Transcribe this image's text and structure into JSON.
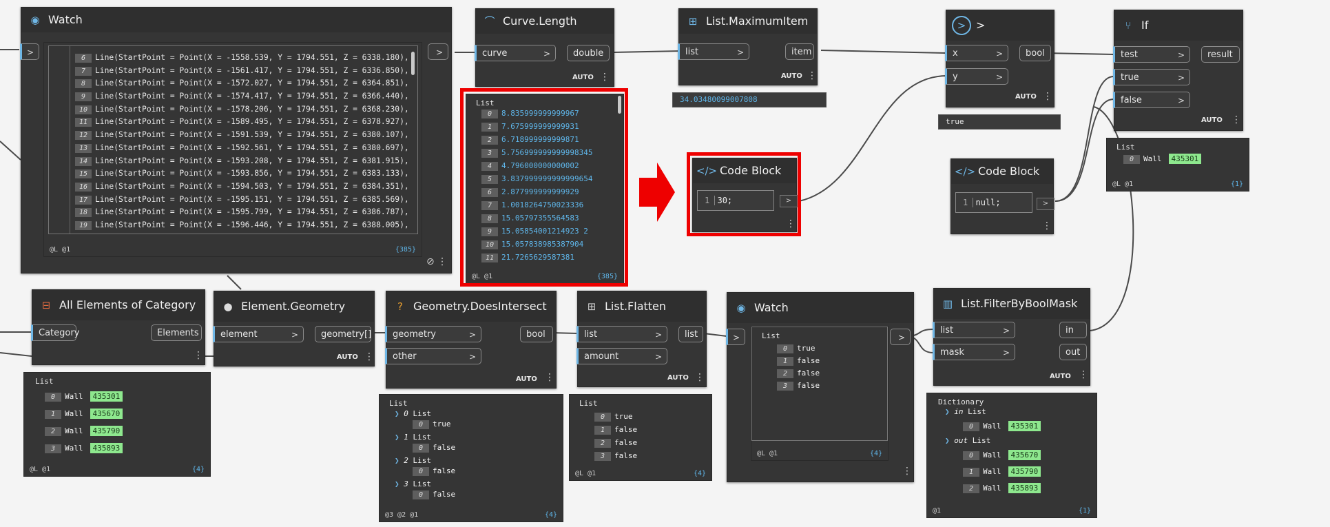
{
  "nodes": {
    "watch_top": {
      "title": "Watch",
      "lines": [
        {
          "i": "6",
          "t": "Line(StartPoint = Point(X = -1558.539, Y = 1794.551, Z = 6338.180),"
        },
        {
          "i": "7",
          "t": "Line(StartPoint = Point(X = -1561.417, Y = 1794.551, Z = 6336.850),"
        },
        {
          "i": "8",
          "t": "Line(StartPoint = Point(X = -1572.027, Y = 1794.551, Z = 6364.851),"
        },
        {
          "i": "9",
          "t": "Line(StartPoint = Point(X = -1574.417, Y = 1794.551, Z = 6366.440),"
        },
        {
          "i": "10",
          "t": "Line(StartPoint = Point(X = -1578.206, Y = 1794.551, Z = 6368.230),"
        },
        {
          "i": "11",
          "t": "Line(StartPoint = Point(X = -1589.495, Y = 1794.551, Z = 6378.927),"
        },
        {
          "i": "12",
          "t": "Line(StartPoint = Point(X = -1591.539, Y = 1794.551, Z = 6380.107),"
        },
        {
          "i": "13",
          "t": "Line(StartPoint = Point(X = -1592.561, Y = 1794.551, Z = 6380.697),"
        },
        {
          "i": "14",
          "t": "Line(StartPoint = Point(X = -1593.208, Y = 1794.551, Z = 6381.915),"
        },
        {
          "i": "15",
          "t": "Line(StartPoint = Point(X = -1593.856, Y = 1794.551, Z = 6383.133),"
        },
        {
          "i": "16",
          "t": "Line(StartPoint = Point(X = -1594.503, Y = 1794.551, Z = 6384.351),"
        },
        {
          "i": "17",
          "t": "Line(StartPoint = Point(X = -1595.151, Y = 1794.551, Z = 6385.569),"
        },
        {
          "i": "18",
          "t": "Line(StartPoint = Point(X = -1595.799, Y = 1794.551, Z = 6386.787),"
        },
        {
          "i": "19",
          "t": "Line(StartPoint = Point(X = -1596.446, Y = 1794.551, Z = 6388.005),"
        }
      ],
      "footer_left": "@L @1",
      "count": "{385}"
    },
    "curve_length": {
      "title": "Curve.Length",
      "in": "curve",
      "out": "double",
      "auto": "AUTO",
      "preview_title": "List",
      "values": [
        {
          "i": "0",
          "v": "8.835999999999967"
        },
        {
          "i": "1",
          "v": "7.675999999999931"
        },
        {
          "i": "2",
          "v": "6.718999999999871"
        },
        {
          "i": "3",
          "v": "5.756999999999998345"
        },
        {
          "i": "4",
          "v": "4.796000000000002"
        },
        {
          "i": "5",
          "v": "3.837999999999999654"
        },
        {
          "i": "6",
          "v": "2.877999999999929"
        },
        {
          "i": "7",
          "v": "1.0018264750023336"
        },
        {
          "i": "8",
          "v": "15.05797355564583"
        },
        {
          "i": "9",
          "v": "15.05854001214923 2"
        },
        {
          "i": "10",
          "v": "15.057838985387904"
        },
        {
          "i": "11",
          "v": "21.7265629587381"
        }
      ],
      "footer_left": "@L @1",
      "count": "{385}"
    },
    "list_max": {
      "title": "List.MaximumItem",
      "in": "list",
      "out": "item",
      "auto": "AUTO",
      "value": "34.03480099007808"
    },
    "code_block_1": {
      "title": "Code Block",
      "line_no": "1",
      "code": "30;"
    },
    "greater": {
      "title": ">",
      "in_x": "x",
      "in_y": "y",
      "out": "bool",
      "auto": "AUTO",
      "value": "true"
    },
    "code_block_2": {
      "title": "Code Block",
      "line_no": "1",
      "code": "null;"
    },
    "if_node": {
      "title": "If",
      "in_test": "test",
      "in_true": "true",
      "in_false": "false",
      "out": "result",
      "auto": "AUTO",
      "preview_title": "List",
      "idx": "0",
      "kw": "Wall",
      "id": "435301",
      "footer_left": "@L @1",
      "count": "{1}"
    },
    "all_elements": {
      "title": "All Elements of Category",
      "in": "Category",
      "out": "Elements",
      "preview_title": "List",
      "items": [
        {
          "i": "0",
          "kw": "Wall",
          "id": "435301"
        },
        {
          "i": "1",
          "kw": "Wall",
          "id": "435670"
        },
        {
          "i": "2",
          "kw": "Wall",
          "id": "435790"
        },
        {
          "i": "3",
          "kw": "Wall",
          "id": "435893"
        }
      ],
      "footer_left": "@L @1",
      "count": "{4}"
    },
    "element_geometry": {
      "title": "Element.Geometry",
      "in": "element",
      "out": "geometry[]",
      "auto": "AUTO"
    },
    "does_intersect": {
      "title": "Geometry.DoesIntersect",
      "in_a": "geometry",
      "in_b": "other",
      "out": "bool",
      "auto": "AUTO",
      "preview_title": "List",
      "groups": [
        {
          "gi": "0",
          "label": "List",
          "i": "0",
          "v": "true"
        },
        {
          "gi": "1",
          "label": "List",
          "i": "0",
          "v": "false"
        },
        {
          "gi": "2",
          "label": "List",
          "i": "0",
          "v": "false"
        },
        {
          "gi": "3",
          "label": "List",
          "i": "0",
          "v": "false"
        }
      ],
      "footer_left": "@3 @2 @1",
      "count": "{4}"
    },
    "list_flatten": {
      "title": "List.Flatten",
      "in_a": "list",
      "in_b": "amount",
      "out": "list",
      "auto": "AUTO",
      "preview_title": "List",
      "items": [
        {
          "i": "0",
          "v": "true"
        },
        {
          "i": "1",
          "v": "false"
        },
        {
          "i": "2",
          "v": "false"
        },
        {
          "i": "3",
          "v": "false"
        }
      ],
      "footer_left": "@L @1",
      "count": "{4}"
    },
    "watch_bottom": {
      "title": "Watch",
      "preview_title": "List",
      "items": [
        {
          "i": "0",
          "v": "true"
        },
        {
          "i": "1",
          "v": "false"
        },
        {
          "i": "2",
          "v": "false"
        },
        {
          "i": "3",
          "v": "false"
        }
      ],
      "footer_left": "@L @1",
      "count": "{4}"
    },
    "filter_mask": {
      "title": "List.FilterByBoolMask",
      "in_a": "list",
      "in_b": "mask",
      "out_a": "in",
      "out_b": "out",
      "auto": "AUTO",
      "preview_title": "Dictionary",
      "in_label": "in",
      "in_type": "List",
      "out_label": "out",
      "out_type": "List",
      "in_items": [
        {
          "i": "0",
          "kw": "Wall",
          "id": "435301"
        }
      ],
      "out_items": [
        {
          "i": "0",
          "kw": "Wall",
          "id": "435670"
        },
        {
          "i": "1",
          "kw": "Wall",
          "id": "435790"
        },
        {
          "i": "2",
          "kw": "Wall",
          "id": "435893"
        }
      ],
      "footer_left": "@1",
      "count": "{1}"
    }
  },
  "accent": {
    "wire": "#4a4a4a",
    "highlight": "#ee0000",
    "value_blue": "#5fb6ea",
    "id_green": "#8ee88e"
  }
}
